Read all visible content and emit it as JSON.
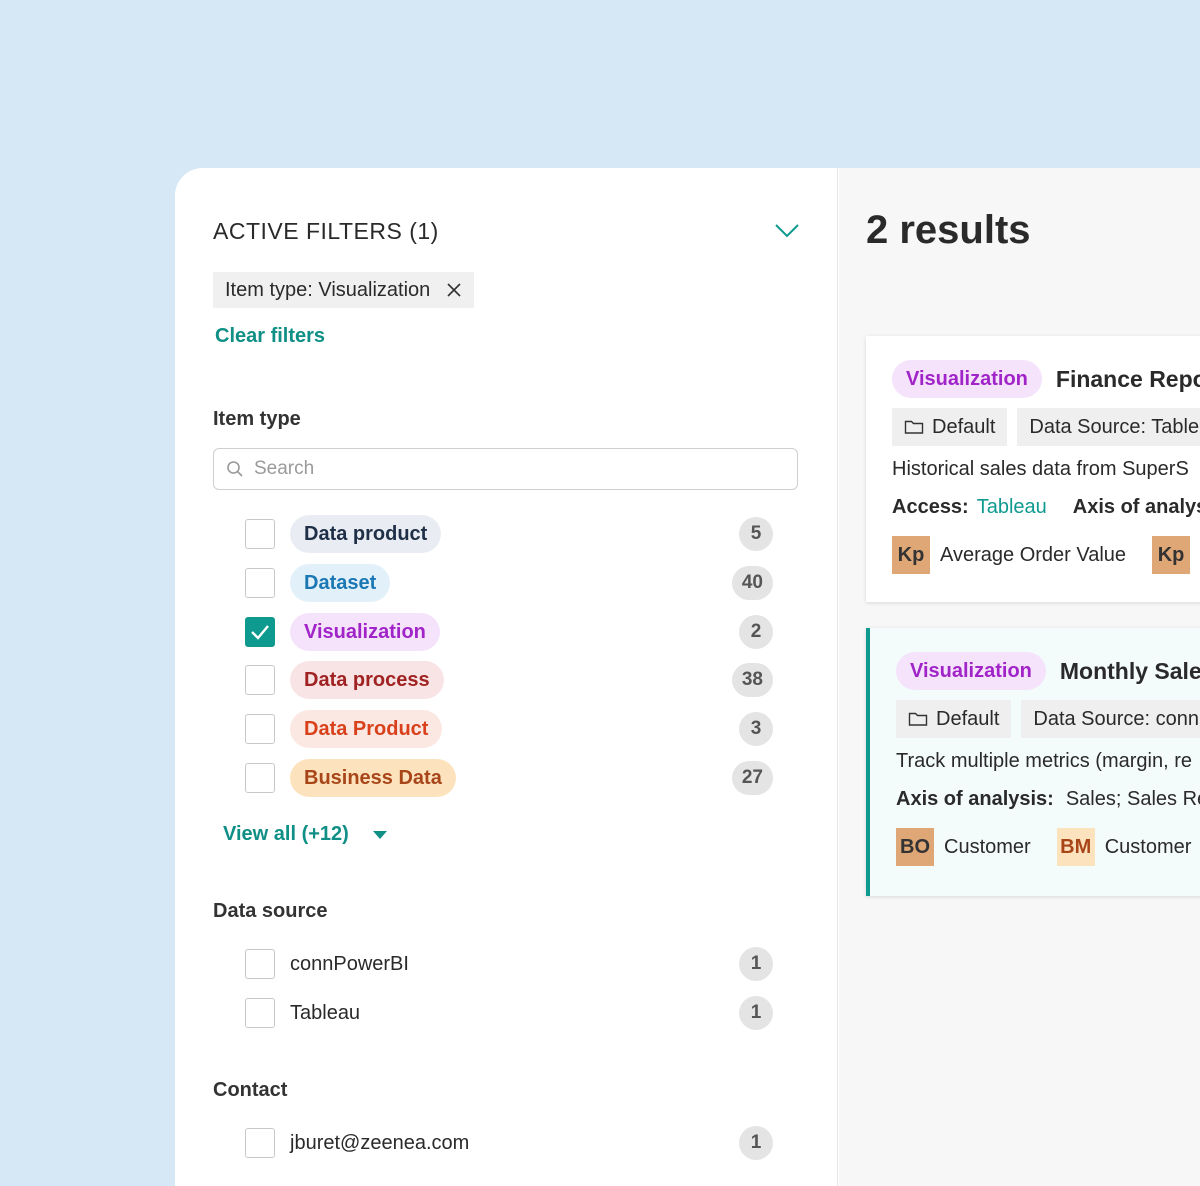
{
  "filters": {
    "active_title": "ACTIVE FILTERS (1)",
    "chip_label": "Item type: Visualization",
    "clear_label": "Clear filters",
    "item_type": {
      "title": "Item type",
      "search_placeholder": "Search",
      "items": [
        {
          "label": "Data product",
          "count": "5",
          "checked": false,
          "bg": "#e9edf3",
          "fg": "#1f2f47"
        },
        {
          "label": "Dataset",
          "count": "40",
          "checked": false,
          "bg": "#e2f0f9",
          "fg": "#1b78b4"
        },
        {
          "label": "Visualization",
          "count": "2",
          "checked": true,
          "bg": "#f5e3fb",
          "fg": "#a124c8"
        },
        {
          "label": "Data process",
          "count": "38",
          "checked": false,
          "bg": "#f8e4e4",
          "fg": "#a02222"
        },
        {
          "label": "Data Product",
          "count": "3",
          "checked": false,
          "bg": "#fbe8e2",
          "fg": "#d9411c"
        },
        {
          "label": "Business Data",
          "count": "27",
          "checked": false,
          "bg": "#fde3bd",
          "fg": "#a8461a"
        }
      ],
      "view_all": "View all (+12)"
    },
    "data_source": {
      "title": "Data source",
      "items": [
        {
          "label": "connPowerBI",
          "count": "1"
        },
        {
          "label": "Tableau",
          "count": "1"
        }
      ]
    },
    "contact": {
      "title": "Contact",
      "items": [
        {
          "label": "jburet@zeenea.com",
          "count": "1"
        }
      ]
    }
  },
  "results": {
    "title": "2 results",
    "cards": [
      {
        "type": "Visualization",
        "title": "Finance Repo",
        "folder": "Default",
        "source": "Data Source: Table",
        "description": "Historical sales data from SuperS",
        "access_label": "Access:",
        "access_value": "Tableau",
        "axis_label": "Axis of analys",
        "axis_value": "",
        "avatar1": "Kp",
        "avatar1_label": "Average Order Value",
        "avatar1_bg": "#e0a776",
        "avatar2": "Kp",
        "avatar2_label": "",
        "avatar2_bg": "#e0a776"
      },
      {
        "type": "Visualization",
        "title": "Monthly Sale",
        "folder": "Default",
        "source": "Data Source: conn",
        "description": "Track multiple metrics (margin, re",
        "axis_label": "Axis of analysis:",
        "axis_value": "Sales;  Sales Re",
        "avatar1": "BO",
        "avatar1_label": "Customer",
        "avatar1_bg": "#e0a776",
        "avatar2": "BM",
        "avatar2_label": "Customer",
        "avatar2_bg": "#fde3bd"
      }
    ]
  }
}
